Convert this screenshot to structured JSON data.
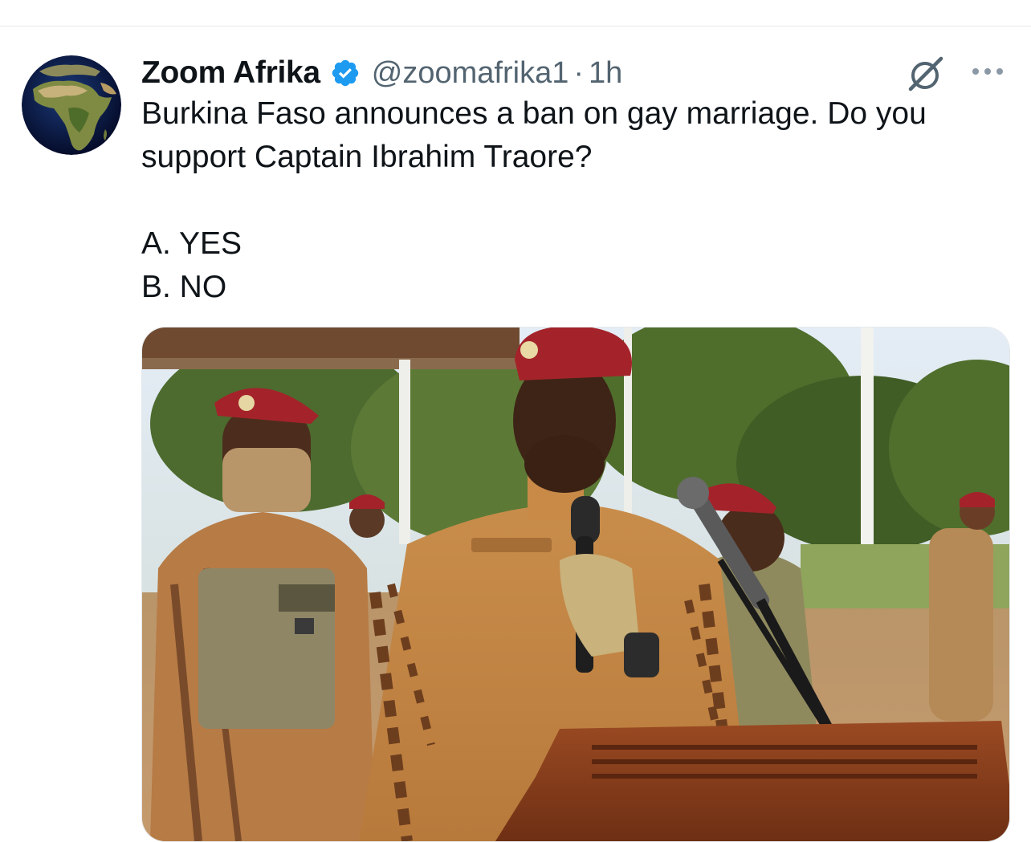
{
  "tweet": {
    "author": {
      "display_name": "Zoom Afrika",
      "handle": "@zoomafrika1",
      "verified": true,
      "avatar_icon": "africa-globe-avatar"
    },
    "separator": "·",
    "time": "1h",
    "text_lines": [
      "Burkina Faso announces a ban on gay marriage. Do you support Captain Ibrahim Traore?",
      "",
      "A. YES",
      "B. NO"
    ],
    "media": {
      "icon": "photo-soldiers-podium"
    },
    "actions": {
      "grok_icon": "grok-icon",
      "more_icon": "more-options-icon"
    }
  },
  "colors": {
    "verified_blue": "#1d9bf0",
    "secondary_text": "#536471",
    "primary_text": "#0f1419",
    "divider": "#e6e8eb"
  }
}
